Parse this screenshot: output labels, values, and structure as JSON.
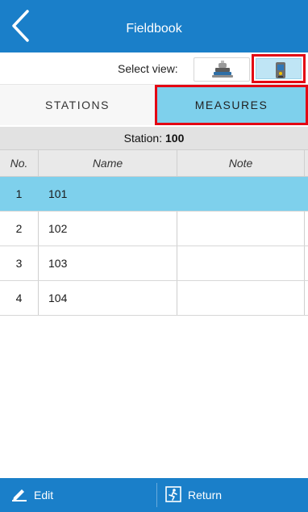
{
  "header": {
    "title": "Fieldbook",
    "back_icon": "chevron-left-icon"
  },
  "view_selector": {
    "label": "Select view:",
    "options": [
      {
        "icon": "total-station-icon",
        "selected": false
      },
      {
        "icon": "gnss-receiver-icon",
        "selected": true
      }
    ]
  },
  "tabs": [
    {
      "label": "STATIONS",
      "active": false
    },
    {
      "label": "MEASURES",
      "active": true
    }
  ],
  "station": {
    "prefix": "Station:",
    "value": "100"
  },
  "table": {
    "columns": [
      "No.",
      "Name",
      "Note"
    ],
    "rows": [
      {
        "no": "1",
        "name": "101",
        "note": "",
        "selected": true
      },
      {
        "no": "2",
        "name": "102",
        "note": "",
        "selected": false
      },
      {
        "no": "3",
        "name": "103",
        "note": "",
        "selected": false
      },
      {
        "no": "4",
        "name": "104",
        "note": "",
        "selected": false
      }
    ]
  },
  "footer": {
    "edit_label": "Edit",
    "edit_icon": "pencil-icon",
    "return_label": "Return",
    "return_icon": "exit-icon"
  },
  "colors": {
    "primary": "#1a7fc9",
    "accent_selected": "#7ed0ec",
    "highlight_frame": "#e30613"
  }
}
